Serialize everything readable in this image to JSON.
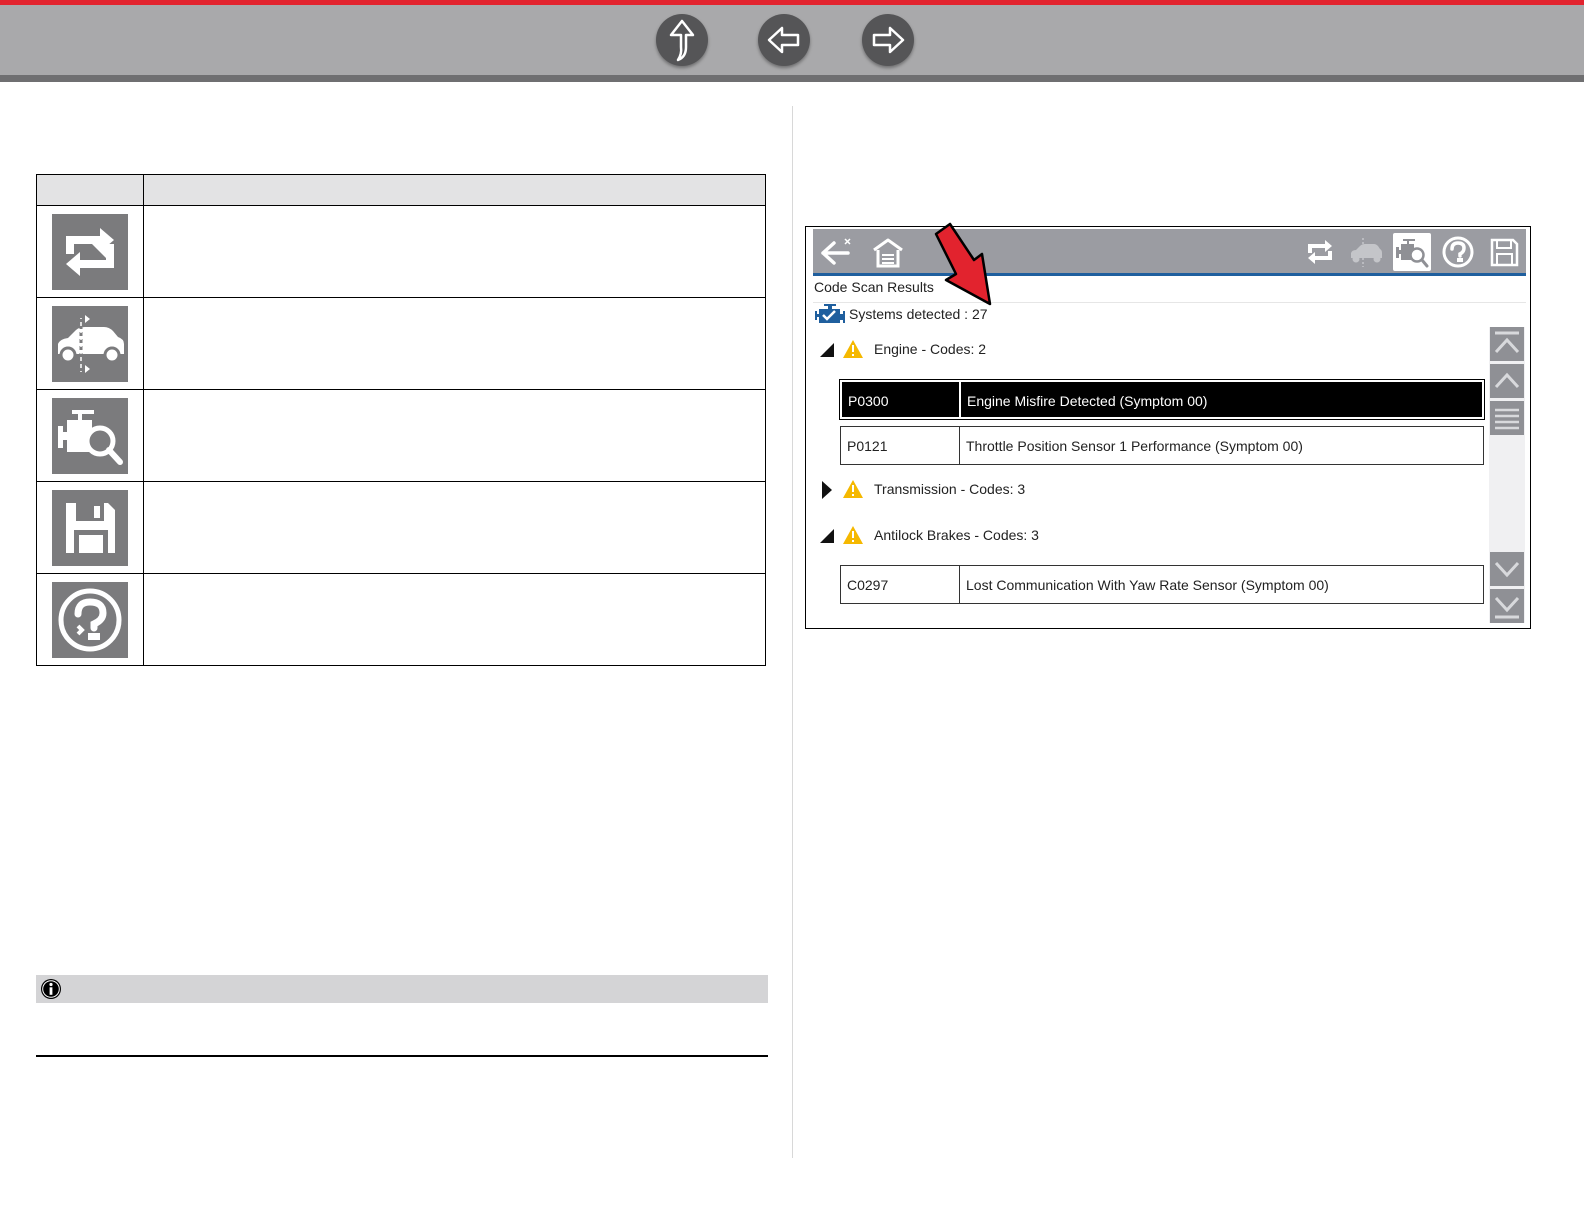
{
  "nav": {
    "buttons": [
      {
        "name": "up",
        "icon": "arrow-up-icon"
      },
      {
        "name": "back",
        "icon": "arrow-left-icon"
      },
      {
        "name": "forward",
        "icon": "arrow-right-icon"
      }
    ],
    "accent_color": "#e2232e"
  },
  "icon_table": {
    "rows": [
      {
        "icon": "refresh-icon"
      },
      {
        "icon": "vehicle-systems-icon"
      },
      {
        "icon": "engine-scan-icon"
      },
      {
        "icon": "save-icon"
      },
      {
        "icon": "help-icon"
      }
    ]
  },
  "note": {
    "icon": "info-icon"
  },
  "device": {
    "toolbar_icons": [
      "back-exit-icon",
      "home-icon",
      "refresh-icon",
      "vehicle-systems-icon",
      "engine-scan-icon",
      "help-icon",
      "save-icon"
    ],
    "title": "Code Scan Results",
    "systems_detected": "Systems detected : 27",
    "groups": [
      {
        "label": "Engine - Codes: 2",
        "expanded": true,
        "codes": [
          {
            "code": "P0300",
            "description": "Engine Misfire Detected (Symptom 00)",
            "selected": true
          },
          {
            "code": "P0121",
            "description": "Throttle Position Sensor 1 Performance (Symptom 00)",
            "selected": false
          }
        ]
      },
      {
        "label": "Transmission - Codes: 3",
        "expanded": false,
        "codes": []
      },
      {
        "label": "Antilock Brakes - Codes: 3",
        "expanded": true,
        "codes": [
          {
            "code": "C0297",
            "description": "Lost Communication With Yaw Rate Sensor (Symptom 00)",
            "selected": false
          }
        ]
      }
    ],
    "scrollbar_buttons": [
      "scroll-top-icon",
      "scroll-up-icon",
      "scroll-thumb",
      "scroll-down-icon",
      "scroll-bottom-icon"
    ],
    "toolbar_color": "#9b9ca2",
    "toolbar_accent": "#1f5f9e",
    "warning_color": "#f5b800",
    "callout_color": "#e2232e"
  }
}
